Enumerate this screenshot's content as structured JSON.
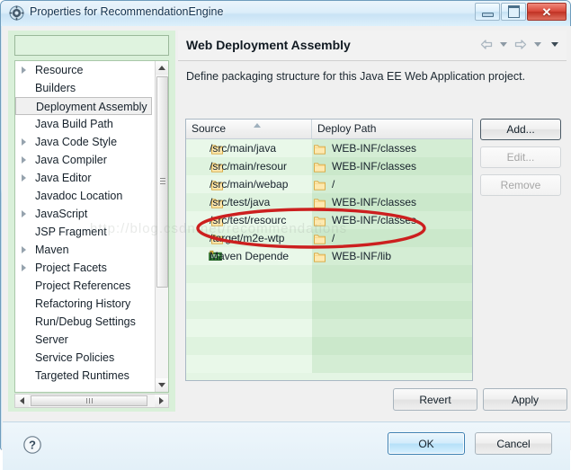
{
  "window": {
    "title": "Properties for RecommendationEngine",
    "icon": "eclipse-properties-icon",
    "controls": {
      "minimize": "minimize-icon",
      "maximize": "maximize-icon",
      "close": "✕"
    }
  },
  "sidebar": {
    "filter": {
      "value": "",
      "placeholder": ""
    },
    "items": [
      {
        "label": "Resource",
        "expandable": true,
        "selected": false
      },
      {
        "label": "Builders",
        "expandable": false,
        "selected": false
      },
      {
        "label": "Deployment Assembly",
        "expandable": false,
        "selected": true
      },
      {
        "label": "Java Build Path",
        "expandable": false,
        "selected": false
      },
      {
        "label": "Java Code Style",
        "expandable": true,
        "selected": false
      },
      {
        "label": "Java Compiler",
        "expandable": true,
        "selected": false
      },
      {
        "label": "Java Editor",
        "expandable": true,
        "selected": false
      },
      {
        "label": "Javadoc Location",
        "expandable": false,
        "selected": false
      },
      {
        "label": "JavaScript",
        "expandable": true,
        "selected": false
      },
      {
        "label": "JSP Fragment",
        "expandable": false,
        "selected": false
      },
      {
        "label": "Maven",
        "expandable": true,
        "selected": false
      },
      {
        "label": "Project Facets",
        "expandable": true,
        "selected": false
      },
      {
        "label": "Project References",
        "expandable": false,
        "selected": false
      },
      {
        "label": "Refactoring History",
        "expandable": false,
        "selected": false
      },
      {
        "label": "Run/Debug Settings",
        "expandable": false,
        "selected": false
      },
      {
        "label": "Server",
        "expandable": false,
        "selected": false
      },
      {
        "label": "Service Policies",
        "expandable": false,
        "selected": false
      },
      {
        "label": "Targeted Runtimes",
        "expandable": false,
        "selected": false
      }
    ]
  },
  "page": {
    "title": "Web Deployment Assembly",
    "description": "Define packaging structure for this Java EE Web Application project.",
    "nav": {
      "back": "back-arrow-icon",
      "back_menu": "chevron-down-icon",
      "forward": "forward-arrow-icon",
      "forward_menu": "chevron-down-icon",
      "view_menu": "chevron-down-icon"
    }
  },
  "table": {
    "columns": [
      "Source",
      "Deploy Path"
    ],
    "sorted_column": "Source",
    "rows": [
      {
        "source": "/src/main/java",
        "deploy": "WEB-INF/classes",
        "icon": "folder-icon"
      },
      {
        "source": "/src/main/resour",
        "deploy": "WEB-INF/classes",
        "icon": "folder-icon"
      },
      {
        "source": "/src/main/webap",
        "deploy": "/",
        "icon": "folder-icon"
      },
      {
        "source": "/src/test/java",
        "deploy": "WEB-INF/classes",
        "icon": "folder-icon"
      },
      {
        "source": "/src/test/resourc",
        "deploy": "WEB-INF/classes",
        "icon": "folder-icon"
      },
      {
        "source": "/target/m2e-wtp",
        "deploy": "/",
        "icon": "folder-icon"
      },
      {
        "source": "Maven Depende",
        "deploy": "WEB-INF/lib",
        "icon": "maven-dependencies-icon"
      }
    ],
    "empty_row_count": 6
  },
  "buttons": {
    "add": "Add...",
    "edit": "Edit...",
    "remove": "Remove",
    "revert": "Revert",
    "apply": "Apply",
    "ok": "OK",
    "cancel": "Cancel",
    "help": "help-icon"
  },
  "annotation": {
    "shape": "red-ellipse-highlight",
    "color": "#cc1f1f",
    "target_row": "Maven Depende"
  },
  "watermark": {
    "text": "http://blog.csdn.net/recommendations"
  }
}
